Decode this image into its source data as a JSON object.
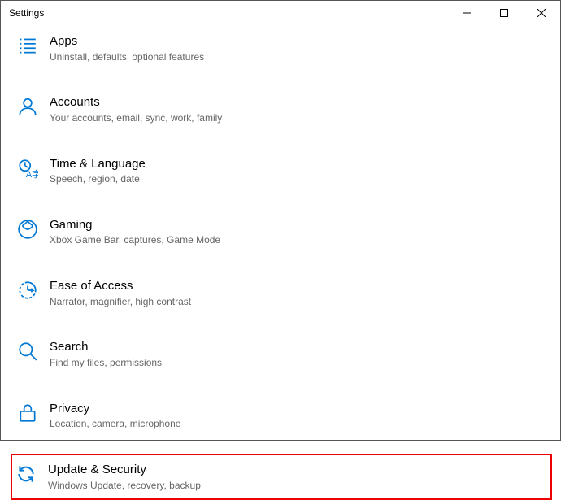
{
  "window": {
    "title": "Settings"
  },
  "categories": [
    {
      "id": "apps",
      "title": "Apps",
      "desc": "Uninstall, defaults, optional features",
      "highlighted": false
    },
    {
      "id": "accounts",
      "title": "Accounts",
      "desc": "Your accounts, email, sync, work, family",
      "highlighted": false
    },
    {
      "id": "time-language",
      "title": "Time & Language",
      "desc": "Speech, region, date",
      "highlighted": false
    },
    {
      "id": "gaming",
      "title": "Gaming",
      "desc": "Xbox Game Bar, captures, Game Mode",
      "highlighted": false
    },
    {
      "id": "ease-of-access",
      "title": "Ease of Access",
      "desc": "Narrator, magnifier, high contrast",
      "highlighted": false
    },
    {
      "id": "search",
      "title": "Search",
      "desc": "Find my files, permissions",
      "highlighted": false
    },
    {
      "id": "privacy",
      "title": "Privacy",
      "desc": "Location, camera, microphone",
      "highlighted": false
    },
    {
      "id": "update-security",
      "title": "Update & Security",
      "desc": "Windows Update, recovery, backup",
      "highlighted": true
    }
  ],
  "accent_color": "#0078d4"
}
